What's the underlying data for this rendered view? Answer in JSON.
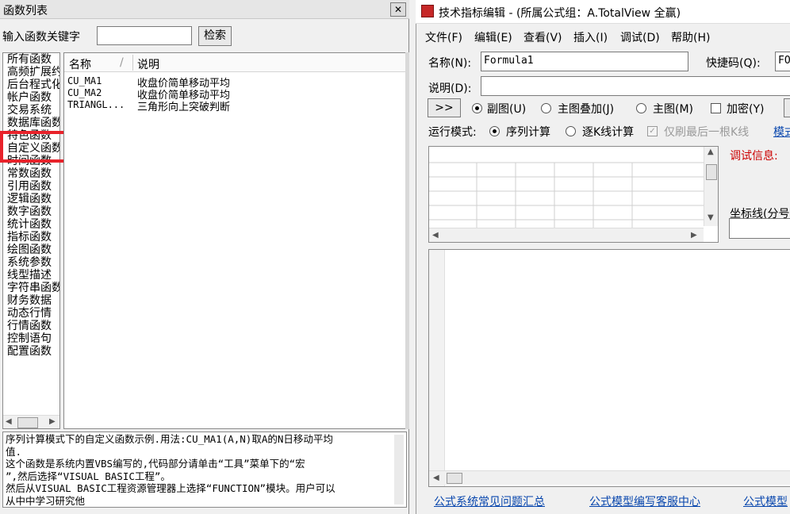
{
  "left_window": {
    "title": "函数列表",
    "close_glyph": "✕",
    "keyword_label": "输入函数关键字",
    "keyword_value": "",
    "search_button": "检索",
    "categories": [
      "所有函数",
      "高频扩展约",
      "后台程式化",
      "帐户函数",
      "交易系统",
      "数据库函数",
      "特色函数",
      "自定义函数",
      "时间函数",
      "常数函数",
      "引用函数",
      "逻辑函数",
      "数字函数",
      "统计函数",
      "指标函数",
      "绘图函数",
      "系统参数",
      "线型描述",
      "字符串函数",
      "财务数据",
      "动态行情",
      "行情函数",
      "控制语句",
      "配置函数"
    ],
    "selected_category": "自定义函数",
    "columns": [
      "名称",
      "说明"
    ],
    "functions": [
      {
        "name": "CU_MA1",
        "desc": "收盘价简单移动平均"
      },
      {
        "name": "CU_MA2",
        "desc": "收盘价简单移动平均"
      },
      {
        "name": "TRIANGL...",
        "desc": "三角形向上突破判断"
      }
    ],
    "description_lines": [
      "序列计算模式下的自定义函数示例.用法:CU_MA1(A,N)取A的N日移动平均",
      "值.",
      " 这个函数是系统内置VBS编写的,代码部分请单击“工具”菜单下的“宏",
      "”,然后选择“VISUAL BASIC工程”。",
      "然后从VISUAL BASIC工程资源管理器上选择“FUNCTION”模块。用户可以",
      "从中中学习研究他"
    ]
  },
  "right_window": {
    "title": "技术指标编辑 - (所属公式组：A.TotalView 全赢)",
    "menu": [
      "文件(F)",
      "编辑(E)",
      "查看(V)",
      "插入(I)",
      "调试(D)",
      "帮助(H)"
    ],
    "name_label": "名称(N):",
    "name_value": "Formula1",
    "shortcut_label": "快捷码(Q):",
    "shortcut_value": "FO",
    "desc_label": "说明(D):",
    "desc_value": "",
    "expand_button": ">>",
    "chart_options": [
      {
        "label": "副图(U)",
        "selected": true
      },
      {
        "label": "主图叠加(J)",
        "selected": false
      },
      {
        "label": "主图(M)",
        "selected": false
      }
    ],
    "encrypt_label": "加密(Y)",
    "run_mode_label": "运行模式:",
    "run_modes": [
      {
        "label": "序列计算",
        "selected": true
      },
      {
        "label": "逐K线计算",
        "selected": false
      }
    ],
    "refresh_last_label": "仅刷最后一根K线",
    "model_link": "模式",
    "debug_label": "调试信息:",
    "coord_label": "坐标线(分号",
    "links": [
      "公式系统常见问题汇总",
      "公式模型编写客服中心",
      "公式模型"
    ]
  }
}
